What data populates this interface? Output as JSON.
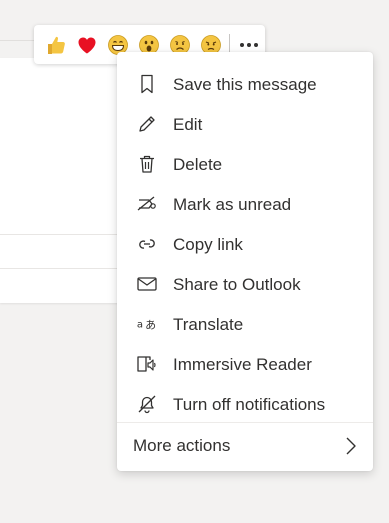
{
  "reactions": [
    {
      "name": "like",
      "icon": "thumbs-up-icon"
    },
    {
      "name": "heart",
      "icon": "heart-icon"
    },
    {
      "name": "laugh",
      "icon": "laugh-icon"
    },
    {
      "name": "surprised",
      "icon": "surprised-icon"
    },
    {
      "name": "sad",
      "icon": "sad-icon"
    },
    {
      "name": "angry",
      "icon": "angry-icon"
    }
  ],
  "reaction_more_icon": "more-options-icon",
  "menu": {
    "items": [
      {
        "label": "Save this message",
        "icon": "bookmark-icon"
      },
      {
        "label": "Edit",
        "icon": "pencil-icon"
      },
      {
        "label": "Delete",
        "icon": "trash-icon"
      },
      {
        "label": "Mark as unread",
        "icon": "unread-icon"
      },
      {
        "label": "Copy link",
        "icon": "link-icon"
      },
      {
        "label": "Share to Outlook",
        "icon": "mail-icon"
      },
      {
        "label": "Translate",
        "icon": "translate-icon"
      },
      {
        "label": "Immersive Reader",
        "icon": "immersive-reader-icon"
      },
      {
        "label": "Turn off notifications",
        "icon": "bell-off-icon"
      }
    ],
    "more_actions_label": "More actions",
    "more_actions_icon": "chevron-right-icon"
  },
  "colors": {
    "heart": "#e81123",
    "emoji": "#f4c542",
    "text": "#323130",
    "icon": "#323130",
    "background": "#f3f2f1"
  }
}
